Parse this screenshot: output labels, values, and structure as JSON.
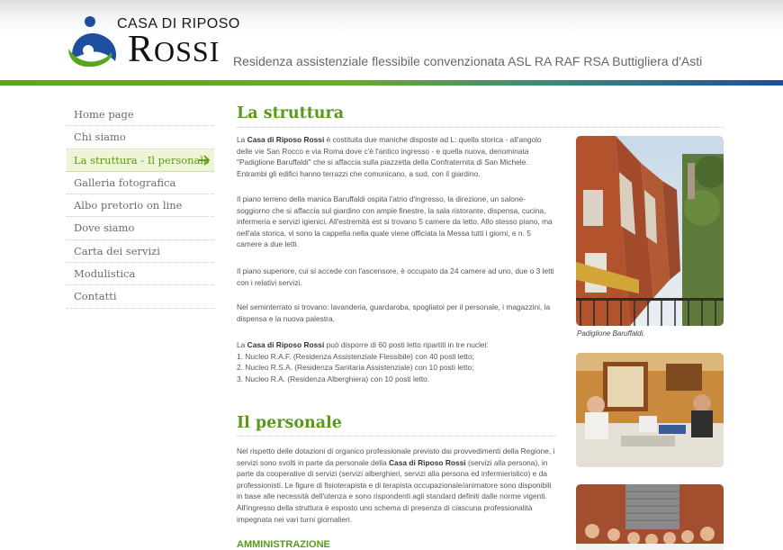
{
  "header": {
    "logo_top": "CASA DI RIPOSO",
    "logo_main_initial": "R",
    "logo_main_rest": "OSSI",
    "tagline": "Residenza assistenziale flessibile convenzionata ASL RA RAF RSA Buttigliera d'Asti"
  },
  "sidebar": {
    "items": [
      {
        "label": "Home page"
      },
      {
        "label": "Chi siamo"
      },
      {
        "label": "La struttura - Il personale"
      },
      {
        "label": "Galleria fotografica"
      },
      {
        "label": "Albo pretorio on line"
      },
      {
        "label": "Dove siamo"
      },
      {
        "label": "Carta dei servizi"
      },
      {
        "label": "Modulistica"
      },
      {
        "label": "Contatti"
      }
    ],
    "active_icon": "arrow-right-icon"
  },
  "main": {
    "title_struttura": "La struttura",
    "p1_pre": "La ",
    "p1_bold": "Casa di Riposo Rossi",
    "p1_post": " è costituita due maniche disposte ad L: quella storica - all'angolo delle vie San Rocco e via Roma dove c'è l'antico ingresso - e quella nuova, denominata \"Padiglione Baruffaldi\" che si affaccia sulla piazzetta della Confraternita di San Michele. Entrambi gli edifici hanno terrazzi che comunicano, a sud, con il giardino.",
    "p2": "Il piano terreno della manica Baruffaldi ospita l'atrio d'ingresso, la direzione, un salone-soggiorno che si affaccia sul giardino con ampie finestre, la sala ristorante, dispensa, cucina, infermeria e servizi igienici. All'estremità est si trovano 5 camere da letto. Allo stesso piano, ma nell'ala storica, vi sono la cappella nella quale viene officiata la Messa tutti i giorni, e n. 5 camere a due letti.",
    "p3": "Il piano superiore, cui si accede con l'ascensore, è occupato da 24 camere ad uno, due o 3 letti con i relativi servizi.",
    "p4": "Nel seminterrato si trovano: lavanderia, guardaroba, spogliatoi per il personale, i magazzini, la dispensa e la nuova palestra.",
    "p5_pre": "La ",
    "p5_bold": "Casa di Riposo Rossi",
    "p5_post": " può disporre di 60 posti letto ripartiti in tre nuclei:",
    "p5_list": [
      "1. Nucleo R.A.F. (Residenza Assistenziale Flessibile) con 40 posti letto;",
      "2. Nucleo R.S.A. (Residenza Sanitaria Assistenziale) con 10 posti letto;",
      "3. Nucleo R.A. (Residenza Alberghiera) con 10 posti letto."
    ],
    "title_personale": "Il personale",
    "p6_pre": "Nel rispetto delle dotazioni di organico professionale previsto dai provvedimenti della Regione, i servizi sono svolti in parte da personale della ",
    "p6_bold": "Casa di Riposo Rossi",
    "p6_post": " (servizi alla persona), in parte da cooperative di servizi (servizi alberghieri, servizi alla persona ed infermieristico) e da professionisti. Le figure di fisioterapista e di terapista occupazionale/animatore sono disponibili in base alle necessità dell'utenza e sono rispondenti agli standard definiti dalle norme vigenti. All'ingresso della struttura è esposto uno schema di presenza di ciascuna professionalità impegnata nei vari turni giornalieri.",
    "subtitle_amministrazione": "AMMINISTRAZIONE"
  },
  "photos": {
    "caption1": "Padiglione Baruffaldi."
  },
  "colors": {
    "accent_green": "#5a9a1a",
    "logo_blue": "#1d4f9e",
    "logo_green": "#5aa51f"
  }
}
